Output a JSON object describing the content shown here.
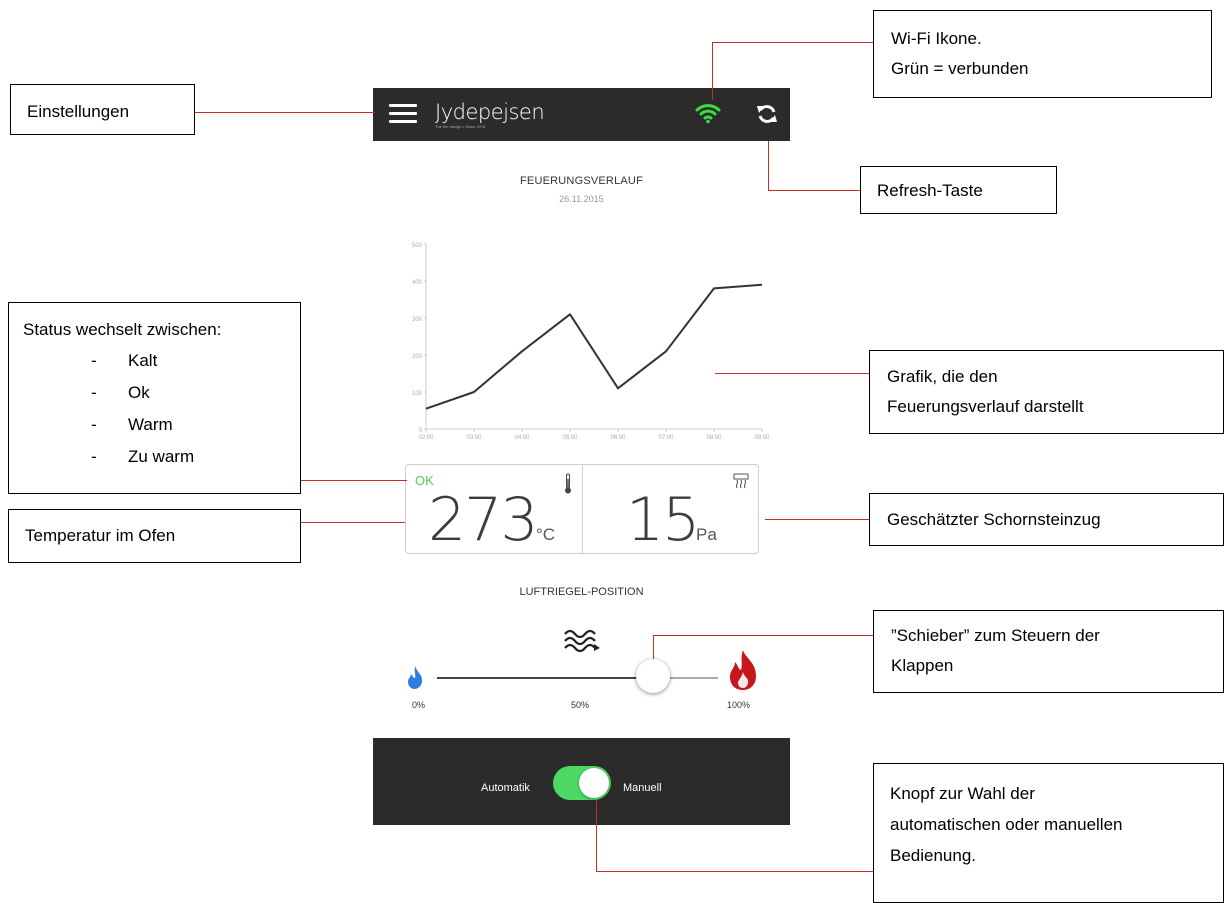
{
  "app": {
    "logo": "Jydepejsen",
    "logo_tagline": "The fire design • Since 1978",
    "wifi_color": "#3ddc3d"
  },
  "history": {
    "title": "FEUERUNGSVERLAUF",
    "date": "26.11.2015"
  },
  "chart_data": {
    "type": "line",
    "x": [
      "02:00",
      "03:00",
      "04:00",
      "05:00",
      "06:00",
      "07:00",
      "08:00",
      "09:00"
    ],
    "y": [
      55,
      100,
      210,
      310,
      110,
      210,
      380,
      390
    ],
    "y_ticks": [
      "0",
      "100",
      "200",
      "300",
      "400",
      "500"
    ],
    "ylim": [
      0,
      500
    ],
    "line_color": "#333333"
  },
  "metrics": {
    "status": "OK",
    "status_color": "#5cc95c",
    "temperature": "273",
    "temperature_unit": "°C",
    "draft": "15",
    "draft_unit": "Pa"
  },
  "damper": {
    "title": "LUFTRIEGEL-POSITION",
    "min_label": "0%",
    "mid_label": "50%",
    "max_label": "100%",
    "position_percent": 80
  },
  "mode": {
    "left_label": "Automatik",
    "right_label": "Manuell",
    "manual_on": true
  },
  "annotations": {
    "settings": "Einstellungen",
    "wifi_line1": "Wi-Fi Ikone.",
    "wifi_line2": "Grün = verbunden",
    "refresh": "Refresh-Taste",
    "status_heading": "Status wechselt zwischen:",
    "status_items": [
      "Kalt",
      "Ok",
      "Warm",
      "Zu warm"
    ],
    "temperature": "Temperatur im Ofen",
    "chart_line1": "Grafik, die den",
    "chart_line2": "Feuerungsverlauf darstellt",
    "draft": "Geschätzter Schornsteinzug",
    "slider_line1": "”Schieber” zum Steuern der",
    "slider_line2": "Klappen",
    "toggle_line1": "Knopf zur Wahl der",
    "toggle_line2": "automatischen oder manuellen",
    "toggle_line3": "Bedienung."
  }
}
